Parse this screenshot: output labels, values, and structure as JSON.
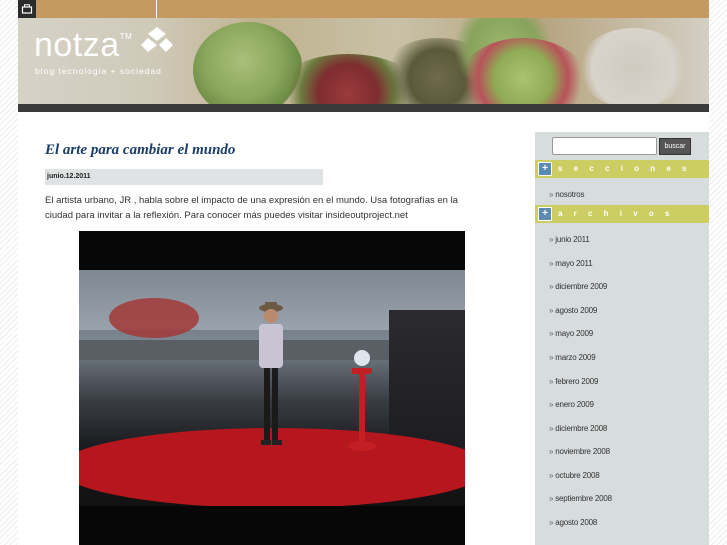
{
  "header": {
    "logo": "notza",
    "trademark": "TM",
    "tagline": "blog tecnologia + sociedad"
  },
  "post": {
    "title": "El arte para cambiar el mundo",
    "date": "junio.12.2011",
    "body": "El artista urbano, JR , habla sobre el impacto de una expresión en el mundo. Usa fotografías en la ciudad para invitar a la reflexión. Para conocer más puedes visitar insideoutproject.net"
  },
  "sidebar": {
    "search_button": "buscar",
    "secciones_label": "s e c c i o n e s",
    "secciones": [
      "nosotros"
    ],
    "archivos_label": "a r c h i v o s",
    "archivos": [
      "junio 2011",
      "mayo 2011",
      "diciembre 2009",
      "agosto 2009",
      "mayo 2009",
      "marzo 2009",
      "febrero 2009",
      "enero 2009",
      "diciembre 2008",
      "noviembre 2008",
      "octubre 2008",
      "septiembre 2008",
      "agosto 2008"
    ],
    "bullet": "»"
  },
  "colors": {
    "topbar": "#c49a62",
    "section_header": "#cccd63",
    "sidebar_bg": "#d7dddd",
    "title_blue": "#1b3d6a",
    "stage_red": "#b6161d"
  }
}
